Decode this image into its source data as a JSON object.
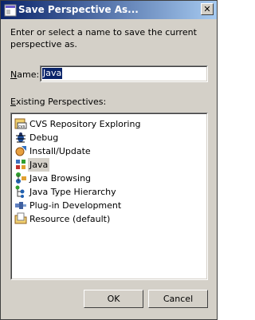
{
  "window": {
    "title": "Save Perspective As...",
    "close_glyph": "✕"
  },
  "instructions": "Enter or select a name to save the current perspective as.",
  "name_field": {
    "label_mnemonic": "N",
    "label_rest": "ame:",
    "value": "Java"
  },
  "list": {
    "label_mnemonic": "E",
    "label_rest": "xisting Perspectives:",
    "items": [
      {
        "label": "CVS Repository Exploring",
        "icon": "cvs-repository-icon"
      },
      {
        "label": "Debug",
        "icon": "debug-bug-icon"
      },
      {
        "label": "Install/Update",
        "icon": "install-update-icon"
      },
      {
        "label": "Java",
        "icon": "java-perspective-icon",
        "selected": true
      },
      {
        "label": "Java Browsing",
        "icon": "java-browsing-icon"
      },
      {
        "label": "Java Type Hierarchy",
        "icon": "type-hierarchy-icon"
      },
      {
        "label": "Plug-in Development",
        "icon": "plugin-icon"
      },
      {
        "label": "Resource (default)",
        "icon": "resource-icon"
      }
    ]
  },
  "buttons": {
    "ok": "OK",
    "cancel": "Cancel"
  },
  "colors": {
    "title_gradient_start": "#0a246a",
    "title_gradient_end": "#a6caf0",
    "dialog_face": "#d4d0c8",
    "selection": "#0a246a"
  }
}
